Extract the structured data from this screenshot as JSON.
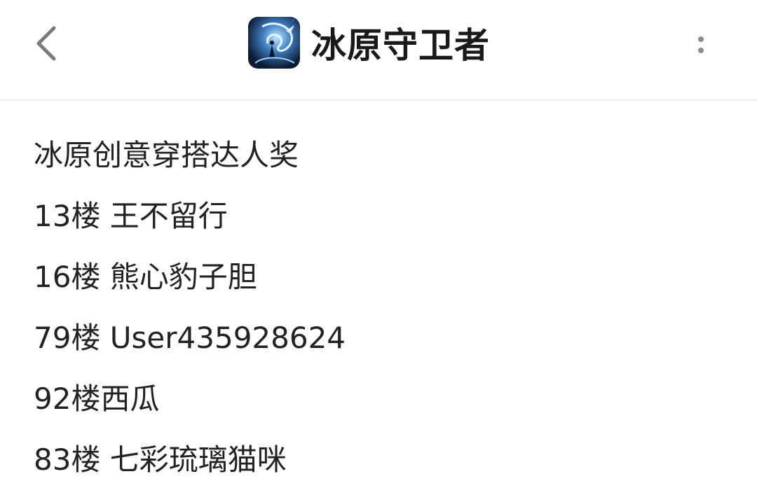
{
  "header": {
    "title": "冰原守卫者",
    "back_icon": "chevron-left-icon",
    "more_icon": "more-vertical-icon",
    "logo_icon": "ice-dragon-game-logo"
  },
  "post": {
    "lines": [
      "冰原创意穿搭达人奖",
      "13楼 王不留行",
      "16楼 熊心豹子胆",
      "79楼 User435928624",
      "92楼西瓜",
      "83楼 七彩琉璃猫咪"
    ]
  },
  "colors": {
    "text": "#222222",
    "divider": "#ececec",
    "icon_gray": "#8a8a8a"
  }
}
